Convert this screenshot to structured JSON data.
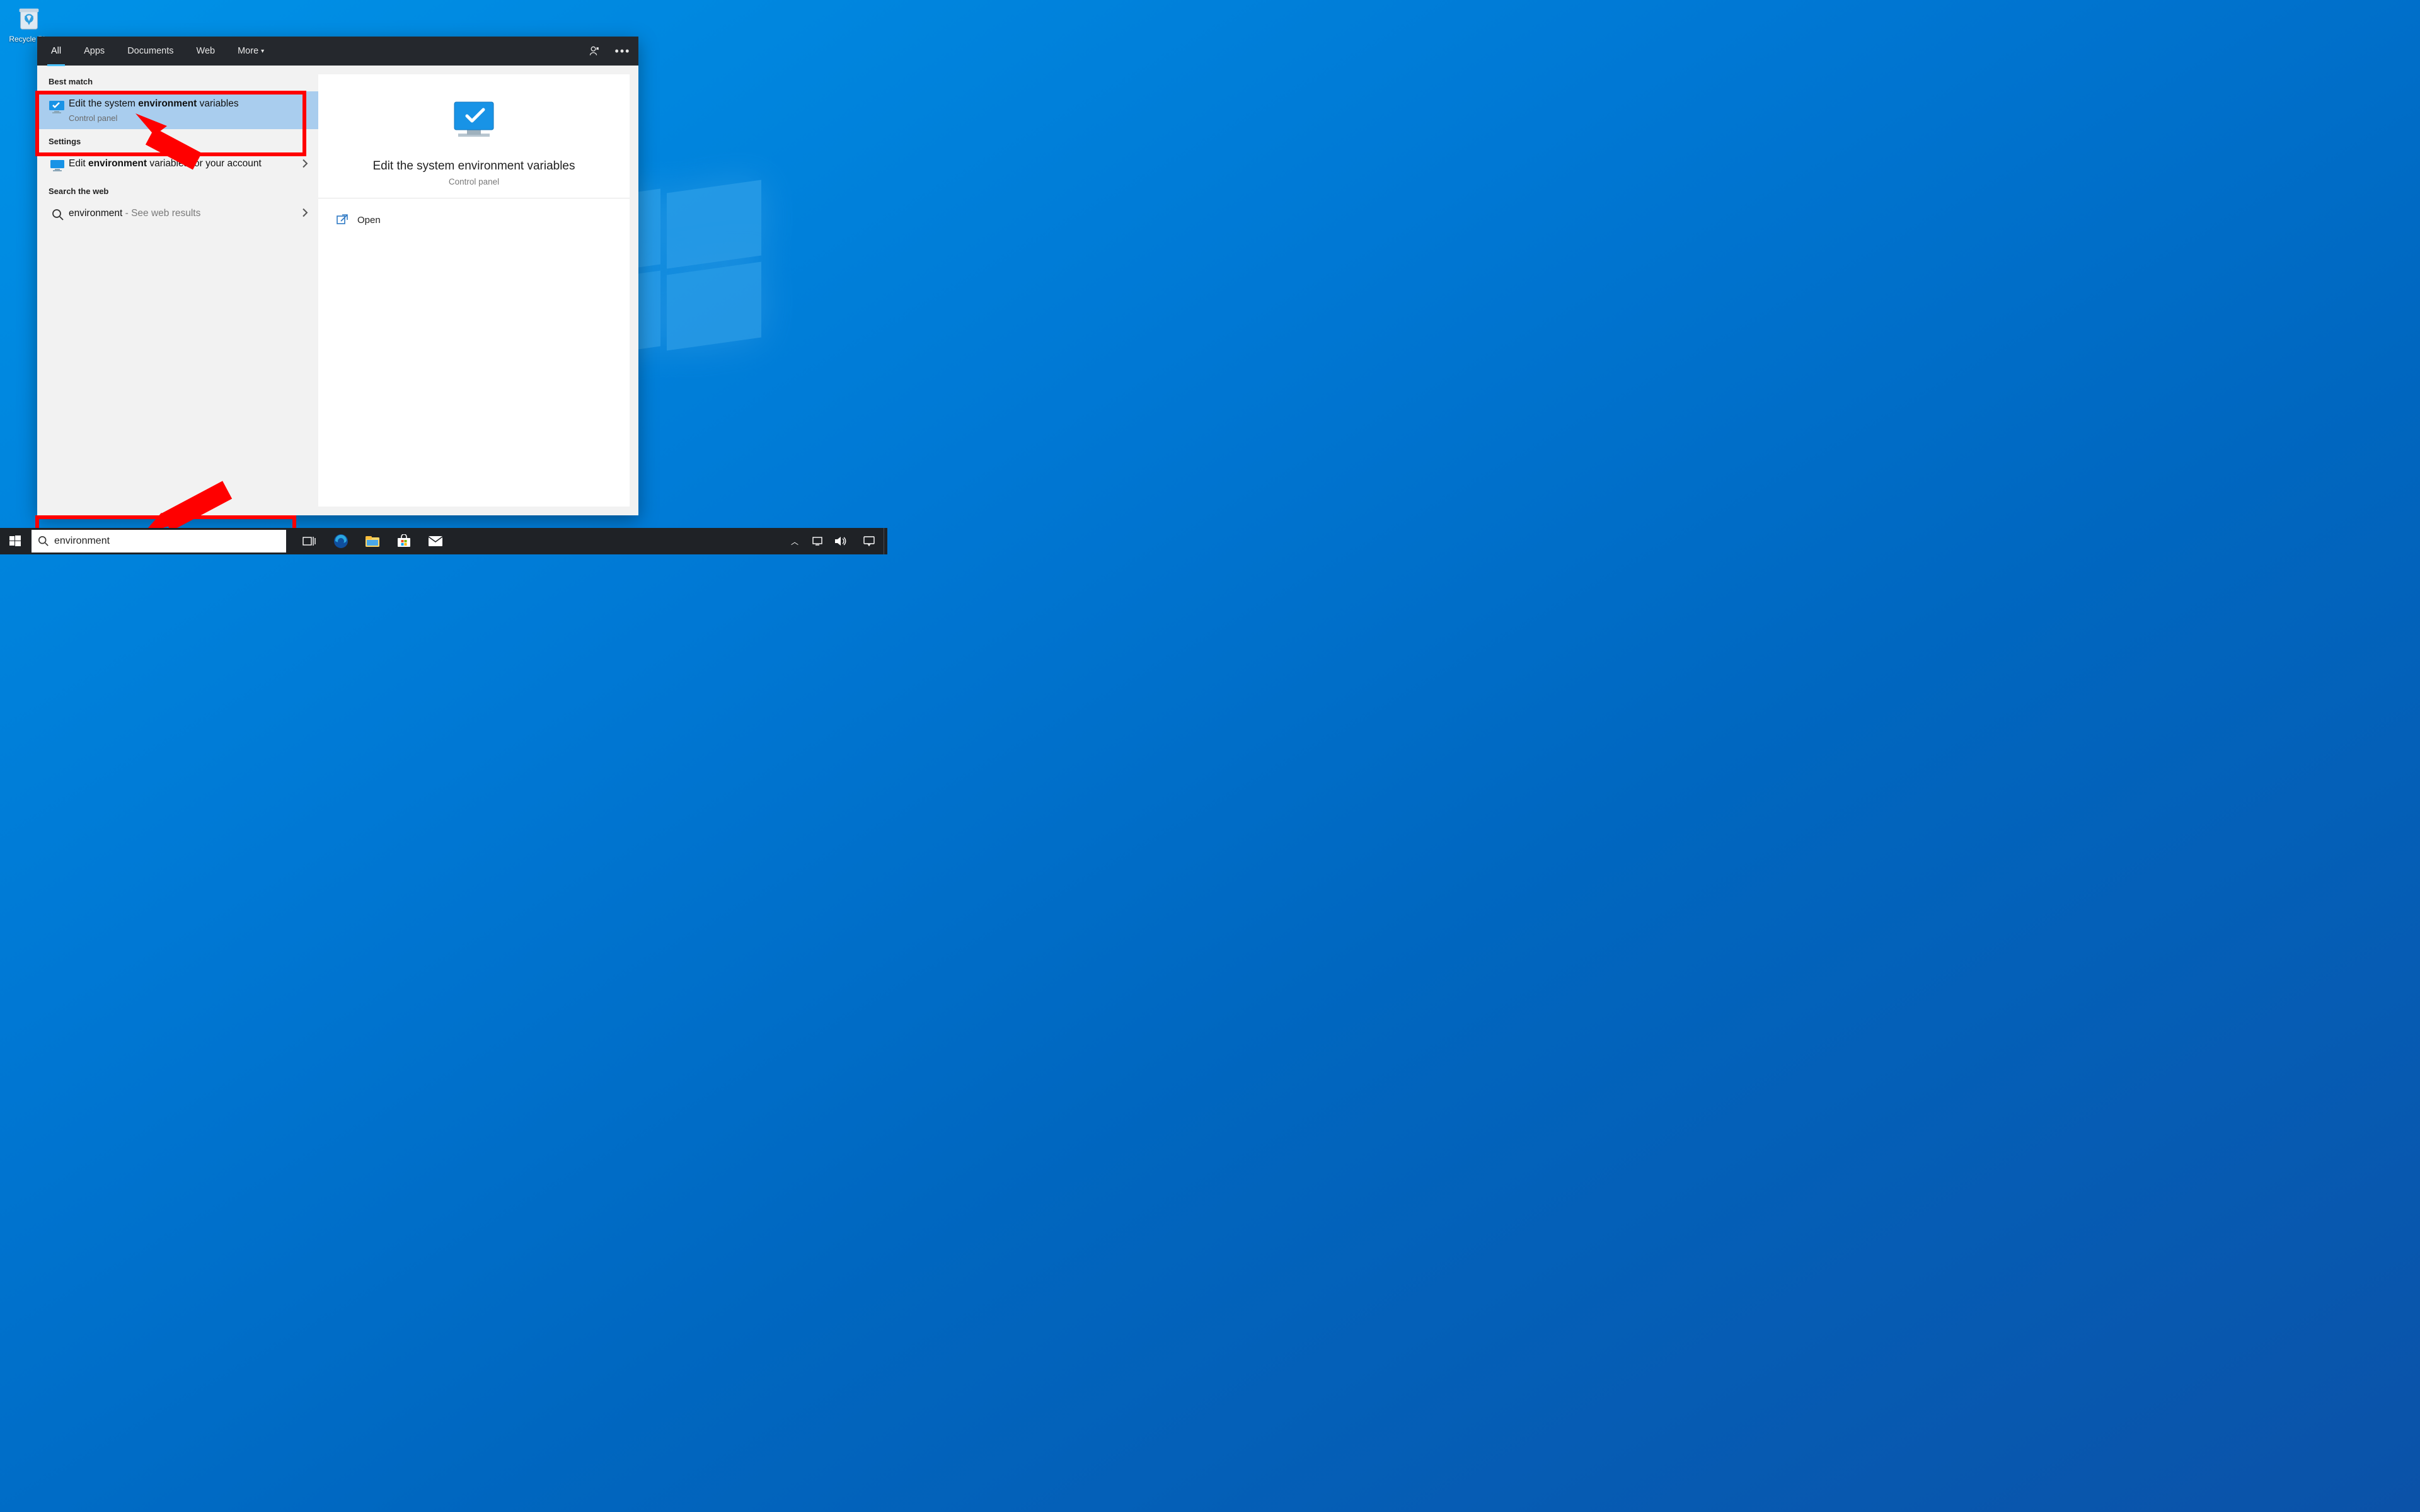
{
  "desktop": {
    "recycle_bin_label": "Recycle Bin"
  },
  "search_panel": {
    "tabs": {
      "all": "All",
      "apps": "Apps",
      "documents": "Documents",
      "web": "Web",
      "more": "More"
    },
    "sections": {
      "best_match": "Best match",
      "settings": "Settings",
      "search_web": "Search the web"
    },
    "results": {
      "best_match": {
        "title_pre": "Edit the system ",
        "title_bold": "environment",
        "title_post": " variables",
        "subtitle": "Control panel"
      },
      "settings_item": {
        "title_pre": "Edit ",
        "title_bold": "environment",
        "title_post": " variables for your account"
      },
      "web_item": {
        "query": "environment",
        "suffix": " - See web results"
      }
    },
    "detail": {
      "title": "Edit the system environment variables",
      "subtitle": "Control panel",
      "open_label": "Open"
    }
  },
  "taskbar": {
    "search_value": "environment"
  }
}
